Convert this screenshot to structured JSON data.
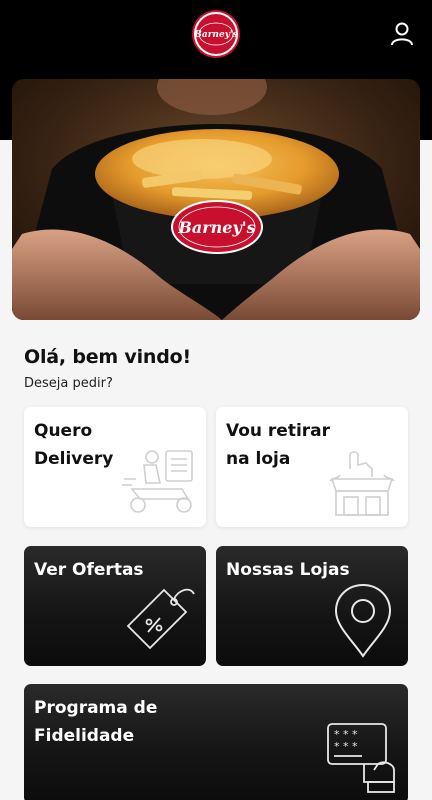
{
  "header": {
    "logo_text": "Barney's",
    "logo_icon": "barneys-logo",
    "user_icon": "user-icon"
  },
  "hero": {
    "logo_text": "Barney's"
  },
  "welcome": {
    "title": "Olá, bem vindo!",
    "subtitle": "Deseja pedir?"
  },
  "cards": {
    "delivery": {
      "line1": "Quero",
      "line2": "Delivery",
      "icon": "delivery-scooter-icon"
    },
    "pickup": {
      "line1": "Vou retirar",
      "line2": "na loja",
      "icon": "store-pickup-icon"
    },
    "offers": {
      "line1": "Ver Ofertas",
      "icon": "discount-tag-icon"
    },
    "stores": {
      "line1": "Nossas Lojas",
      "icon": "location-pin-icon"
    },
    "loyalty": {
      "line1": "Programa de",
      "line2": "Fidelidade",
      "icon": "loyalty-card-icon"
    }
  },
  "colors": {
    "brand_red": "#c8102e",
    "header_bg": "#000000",
    "page_bg": "#f5f5f5"
  }
}
